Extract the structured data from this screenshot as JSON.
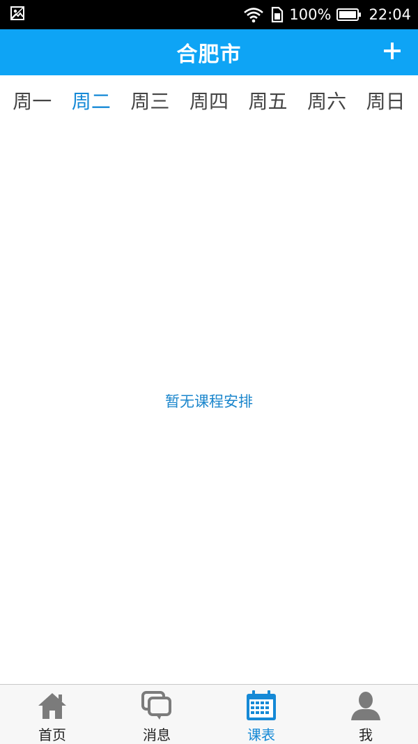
{
  "status_bar": {
    "battery": "100%",
    "time": "22:04"
  },
  "header": {
    "title": "合肥市",
    "add_icon": "plus-icon"
  },
  "week_tabs": [
    {
      "label": "周一",
      "active": false
    },
    {
      "label": "周二",
      "active": true
    },
    {
      "label": "周三",
      "active": false
    },
    {
      "label": "周四",
      "active": false
    },
    {
      "label": "周五",
      "active": false
    },
    {
      "label": "周六",
      "active": false
    },
    {
      "label": "周日",
      "active": false
    }
  ],
  "main": {
    "empty_text": "暂无课程安排"
  },
  "bottom_nav": [
    {
      "label": "首页",
      "icon": "home-icon",
      "active": false
    },
    {
      "label": "消息",
      "icon": "message-icon",
      "active": false
    },
    {
      "label": "课表",
      "icon": "calendar-icon",
      "active": true
    },
    {
      "label": "我",
      "icon": "user-icon",
      "active": false
    }
  ],
  "colors": {
    "header_bg": "#0ea4f5",
    "accent": "#1589d6",
    "inactive_icon": "#7b7b7b"
  }
}
